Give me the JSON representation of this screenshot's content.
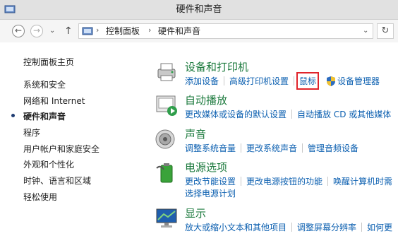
{
  "window": {
    "title": "硬件和声音"
  },
  "nav": {
    "back": "←",
    "forward": "→",
    "up": "↑",
    "breadcrumbs": [
      "控制面板",
      "硬件和声音"
    ],
    "separator": "›",
    "dropdown": "⌄",
    "refresh": "↻"
  },
  "sidebar": {
    "items": [
      {
        "label": "控制面板主页",
        "active": false
      },
      {
        "label": "系统和安全",
        "active": false
      },
      {
        "label": "网络和 Internet",
        "active": false
      },
      {
        "label": "硬件和声音",
        "active": true
      },
      {
        "label": "程序",
        "active": false
      },
      {
        "label": "用户帐户和家庭安全",
        "active": false
      },
      {
        "label": "外观和个性化",
        "active": false
      },
      {
        "label": "时钟、语言和区域",
        "active": false
      },
      {
        "label": "轻松使用",
        "active": false
      }
    ]
  },
  "categories": [
    {
      "title": "设备和打印机",
      "icon": "printer-icon",
      "tasks": [
        "添加设备",
        "高级打印机设置",
        "鼠标",
        "设备管理器"
      ]
    },
    {
      "title": "自动播放",
      "icon": "autoplay-icon",
      "tasks": [
        "更改媒体或设备的默认设置",
        "自动播放 CD 或其他媒体"
      ]
    },
    {
      "title": "声音",
      "icon": "speaker-icon",
      "tasks": [
        "调整系统音量",
        "更改系统声音",
        "管理音频设备"
      ]
    },
    {
      "title": "电源选项",
      "icon": "battery-icon",
      "tasks": [
        "更改节能设置",
        "更改电源按钮的功能",
        "唤醒计算机时需",
        "选择电源计划"
      ]
    },
    {
      "title": "显示",
      "icon": "display-icon",
      "tasks": [
        "放大或缩小文本和其他项目",
        "调整屏幕分辨率",
        "如何更"
      ]
    }
  ],
  "colors": {
    "category_title": "#1e7b3f",
    "link": "#0b5fb0",
    "highlight": "#e0242b"
  }
}
